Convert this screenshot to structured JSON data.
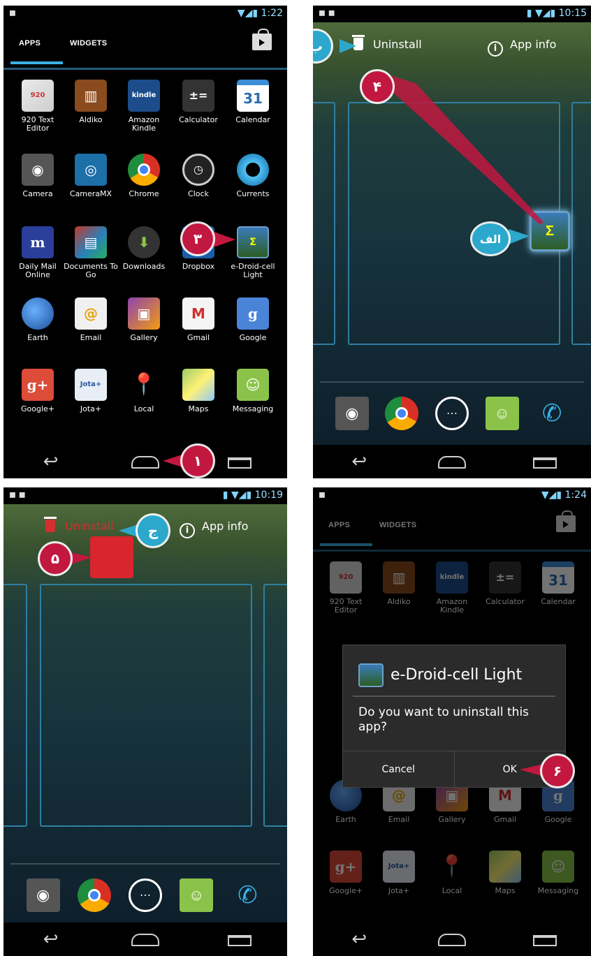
{
  "panel1": {
    "status_left": "■",
    "status_time": "1:22",
    "tabs": [
      "APPS",
      "WIDGETS"
    ],
    "apps": [
      "920 Text Editor",
      "Aldiko",
      "Amazon Kindle",
      "Calculator",
      "Calendar",
      "Camera",
      "CameraMX",
      "Chrome",
      "Clock",
      "Currents",
      "Daily Mail Online",
      "Documents To Go",
      "Downloads",
      "Dropbox",
      "e-Droid-cell Light",
      "Earth",
      "Email",
      "Gallery",
      "Gmail",
      "Google",
      "Google+",
      "Jota+",
      "Local",
      "Maps",
      "Messaging"
    ],
    "callouts": [
      "۳",
      "۱"
    ]
  },
  "panel2": {
    "status_time": "10:15",
    "uninstall": "Uninstall",
    "app_info": "App info",
    "callouts": [
      "ب",
      "۴",
      "الف"
    ]
  },
  "panel3": {
    "status_time": "10:19",
    "uninstall": "Uninstall",
    "app_info": "App info",
    "callouts": [
      "ج",
      "۵"
    ]
  },
  "panel4": {
    "status_time": "1:24",
    "tabs": [
      "APPS",
      "WIDGETS"
    ],
    "dialog_title": "e-Droid-cell Light",
    "dialog_message": "Do you want to uninstall this app?",
    "cancel": "Cancel",
    "ok": "OK",
    "callouts": [
      "۶"
    ]
  },
  "colors": {
    "callout_red": "#c21840",
    "callout_blue": "#2ba8cc",
    "accent": "#3ab0e6"
  }
}
